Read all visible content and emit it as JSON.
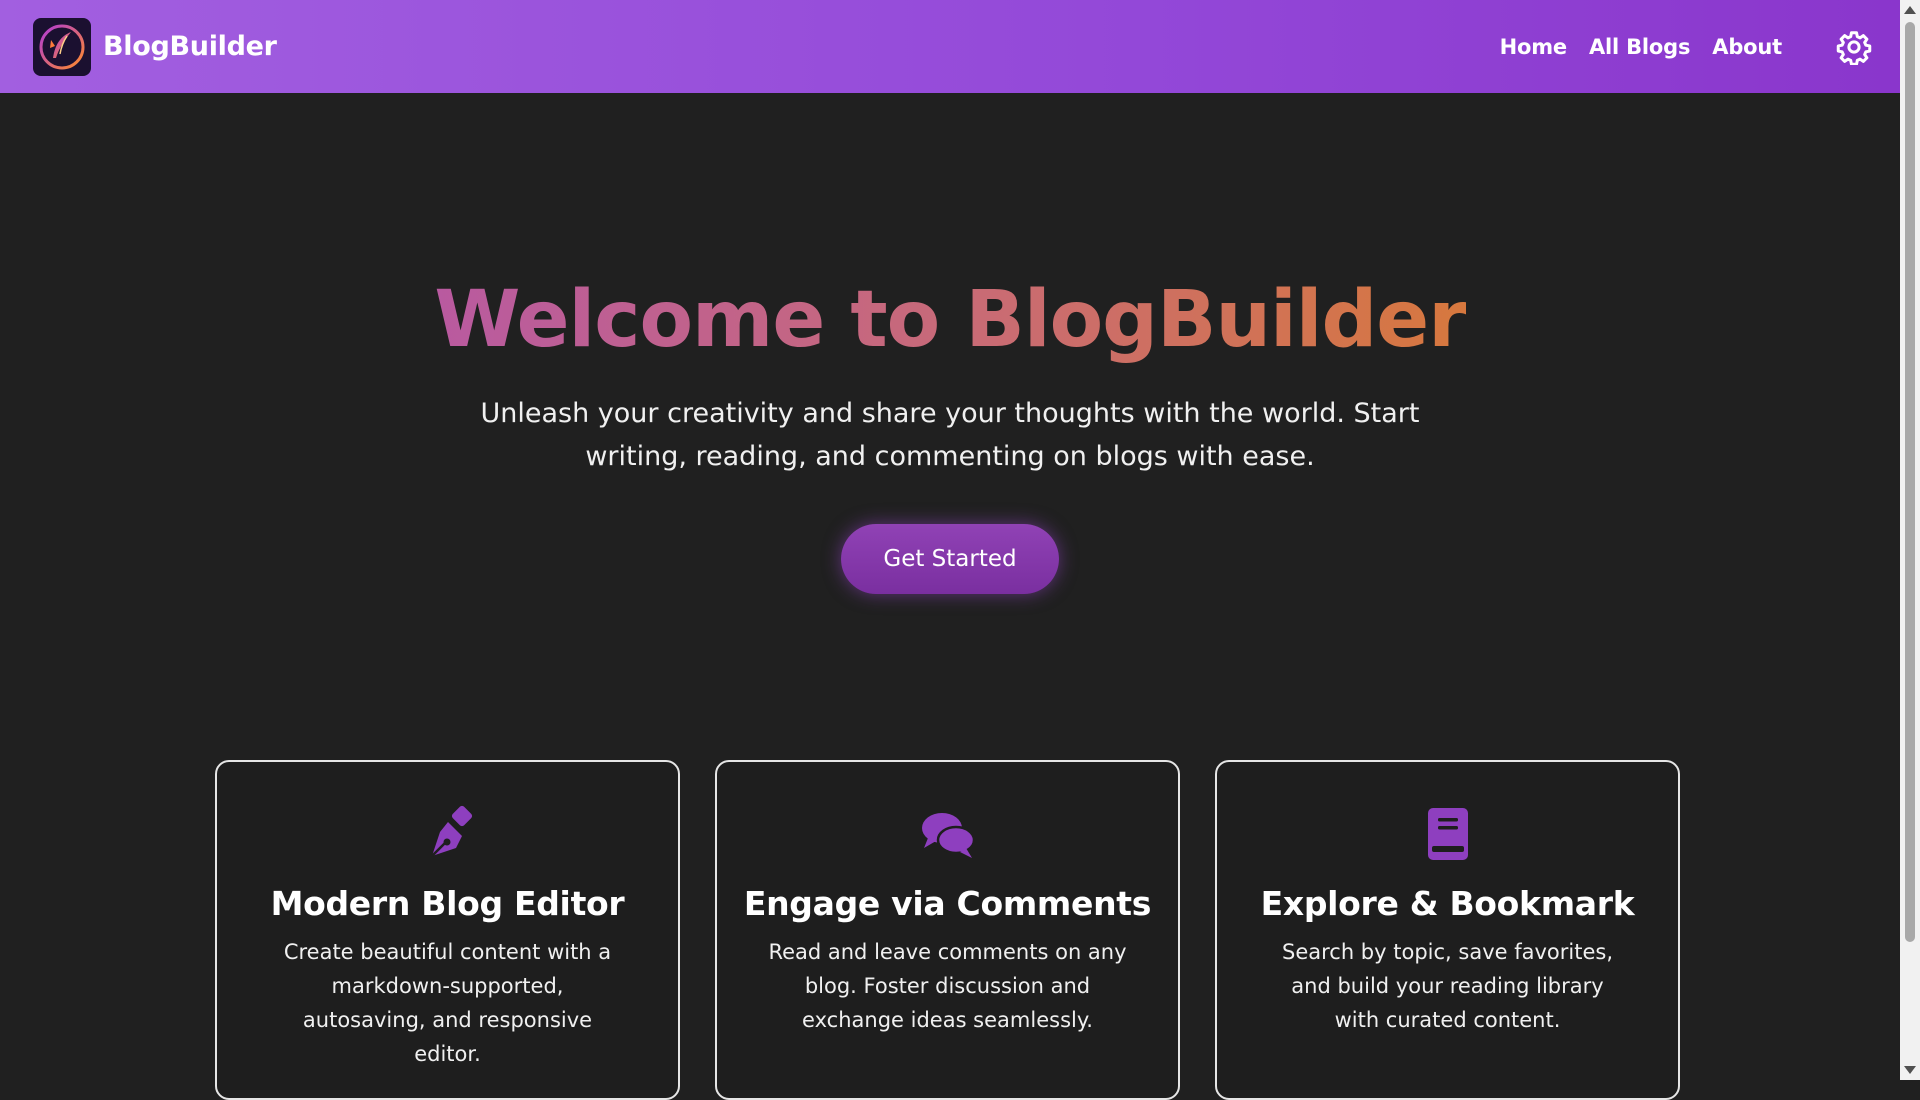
{
  "app": {
    "brand_name": "BlogBuilder"
  },
  "nav": {
    "items": [
      {
        "label": "Home"
      },
      {
        "label": "All Blogs"
      },
      {
        "label": "About"
      }
    ]
  },
  "hero": {
    "title": "Welcome to BlogBuilder",
    "subtitle": "Unleash your creativity and share your thoughts with the world. Start writing, reading, and commenting on blogs with ease.",
    "cta_label": "Get Started"
  },
  "features": [
    {
      "icon": "pen-nib-icon",
      "title": "Modern Blog Editor",
      "text": "Create beautiful content with a markdown-supported, autosaving, and responsive editor."
    },
    {
      "icon": "comments-icon",
      "title": "Engage via Comments",
      "text": "Read and leave comments on any blog. Foster discussion and exchange ideas seamlessly."
    },
    {
      "icon": "book-icon",
      "title": "Explore & Bookmark",
      "text": "Search by topic, save favorites, and build your reading library with curated content."
    }
  ],
  "colors": {
    "navbar": "#9348d8",
    "accent": "#8e3fbf",
    "background": "#202020",
    "title_gradient_start": "#b95aa0",
    "title_gradient_end": "#d7783e"
  }
}
